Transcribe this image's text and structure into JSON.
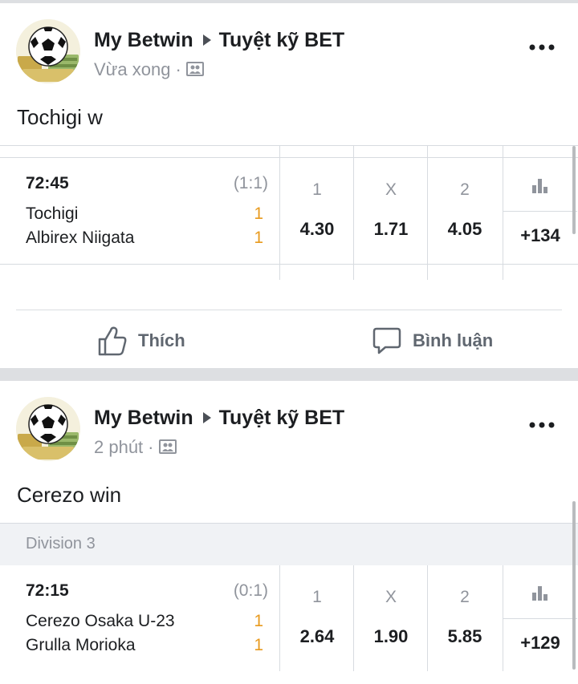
{
  "posts": [
    {
      "author": "My Betwin",
      "group": "Tuyệt kỹ BET",
      "time": "Vừa xong",
      "text": "Tochigi w",
      "match": {
        "time": "72:45",
        "score": "(1:1)",
        "home": "Tochigi",
        "away": "Albirex Niigata",
        "home_goals": "1",
        "away_goals": "1",
        "odds": [
          {
            "label": "1",
            "value": "4.30"
          },
          {
            "label": "X",
            "value": "1.71"
          },
          {
            "label": "2",
            "value": "4.05"
          }
        ],
        "more": "+134"
      },
      "actions": {
        "like": "Thích",
        "comment": "Bình luận"
      }
    },
    {
      "author": "My Betwin",
      "group": "Tuyệt kỹ BET",
      "time": "2 phút",
      "text": "Cerezo win",
      "division": "Division 3",
      "match": {
        "time": "72:15",
        "score": "(0:1)",
        "home": "Cerezo Osaka U-23",
        "away": "Grulla Morioka",
        "home_goals": "1",
        "away_goals": "1",
        "odds": [
          {
            "label": "1",
            "value": "2.64"
          },
          {
            "label": "X",
            "value": "1.90"
          },
          {
            "label": "2",
            "value": "5.85"
          }
        ],
        "more": "+129"
      }
    }
  ],
  "icons": {
    "avatar": "soccer-ball-money-icon",
    "audience": "group-audience-icon",
    "more": "more-options-icon",
    "stats": "bar-chart-icon",
    "like": "thumbs-up-icon",
    "comment": "comment-bubble-icon"
  },
  "colors": {
    "goal": "#e89a1e",
    "muted": "#90949c",
    "text": "#1c1e21"
  }
}
